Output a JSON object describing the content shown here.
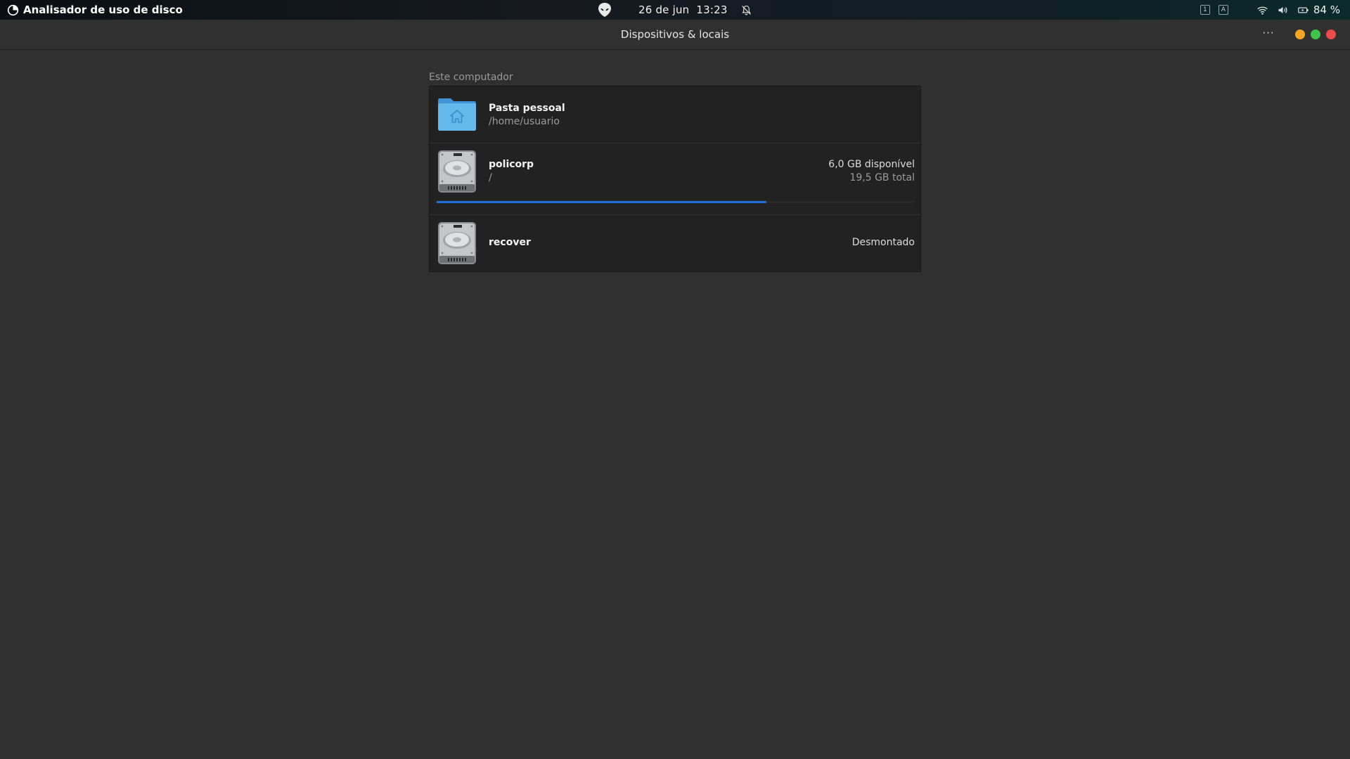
{
  "top_panel": {
    "app_name": "Analisador de uso de disco",
    "date": "26 de jun",
    "time": "13:23",
    "workspace_1": "1",
    "workspace_2": "A",
    "battery_percent": "84 %"
  },
  "window": {
    "title": "Dispositivos & locais",
    "menu_glyph": "···"
  },
  "section": {
    "label": "Este computador"
  },
  "devices": [
    {
      "name": "Pasta pessoal",
      "path": "/home/usuario",
      "icon": "home-folder-icon"
    },
    {
      "name": "policorp",
      "path": "/",
      "available": "6,0 GB disponível",
      "total": "19,5 GB total",
      "used_fraction": 0.69,
      "icon": "hard-disk-icon"
    },
    {
      "name": "recover",
      "status": "Desmontado",
      "icon": "hard-disk-icon"
    }
  ],
  "colors": {
    "usage_bar": "#1e6fe0",
    "folder": "#5bb3ea",
    "minimize": "#f6a623",
    "maximize": "#3fc24a",
    "close": "#ee4b4b"
  }
}
